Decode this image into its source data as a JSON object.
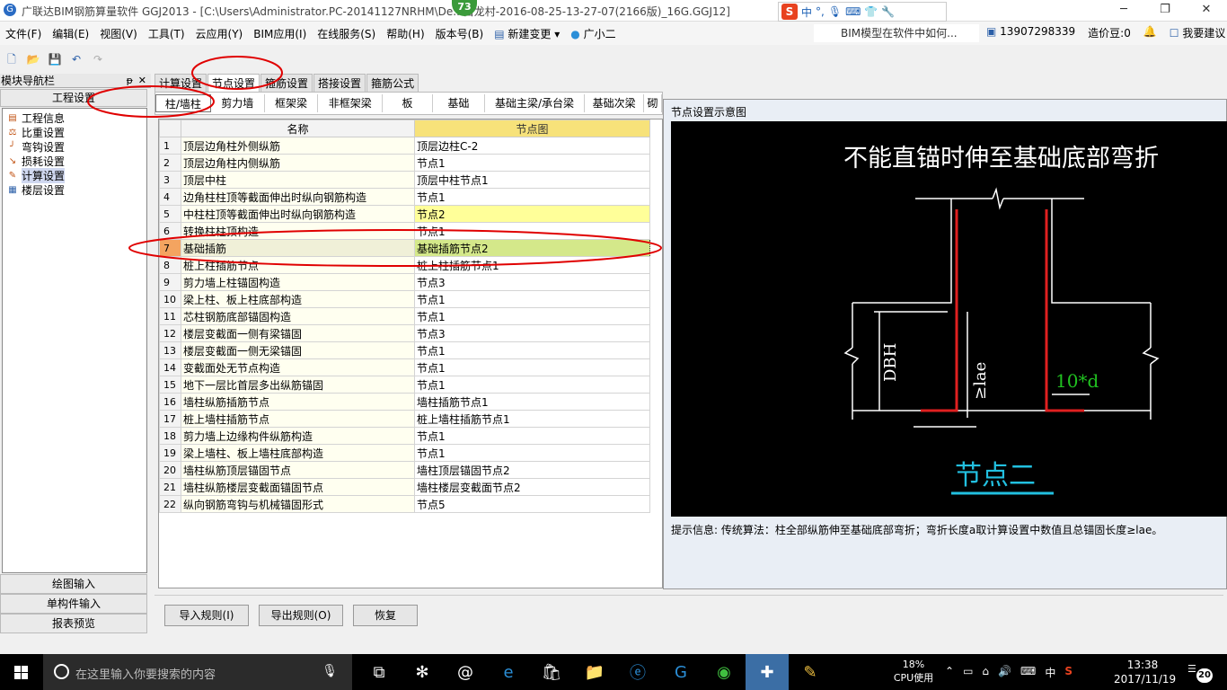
{
  "window": {
    "title": "广联达BIM钢筋算量软件 GGJ2013 - [C:\\Users\\Administrator.PC-20141127NRHM\\De...白龙村-2016-08-25-13-27-07(2166版)_16G.GGJ12]",
    "badge": "73",
    "ime": {
      "mode": "中"
    }
  },
  "menu": {
    "items": [
      "文件(F)",
      "编辑(E)",
      "视图(V)",
      "工具(T)",
      "云应用(Y)",
      "BIM应用(I)",
      "在线服务(S)",
      "帮助(H)",
      "版本号(B)",
      "新建变更",
      "广小二"
    ],
    "bim_hint": "BIM模型在软件中如何...",
    "phone": "13907298339",
    "points": "造价豆:0",
    "suggest": "我要建议"
  },
  "nav": {
    "title": "模块导航栏",
    "section": "工程设置",
    "tree": [
      {
        "label": "工程信息",
        "icon": "info-icon"
      },
      {
        "label": "比重设置",
        "icon": "weight-icon"
      },
      {
        "label": "弯钩设置",
        "icon": "hook-icon"
      },
      {
        "label": "损耗设置",
        "icon": "loss-icon"
      },
      {
        "label": "计算设置",
        "icon": "calc-icon",
        "selected": true
      },
      {
        "label": "楼层设置",
        "icon": "floor-icon"
      }
    ],
    "bottom": [
      "绘图输入",
      "单构件输入",
      "报表预览"
    ]
  },
  "main_tabs": [
    "计算设置",
    "节点设置",
    "箍筋设置",
    "搭接设置",
    "箍筋公式"
  ],
  "active_main_tab": 1,
  "sub_tabs": [
    "柱/墙柱",
    "剪力墙",
    "框架梁",
    "非框架梁",
    "板",
    "基础",
    "基础主梁/承台梁",
    "基础次梁",
    "砌"
  ],
  "grid": {
    "headers": {
      "name": "名称",
      "node": "节点图"
    },
    "rows": [
      {
        "n": "1",
        "name": "顶层边角柱外侧纵筋",
        "node": "顶层边柱C-2"
      },
      {
        "n": "2",
        "name": "顶层边角柱内侧纵筋",
        "node": "节点1"
      },
      {
        "n": "3",
        "name": "顶层中柱",
        "node": "顶层中柱节点1"
      },
      {
        "n": "4",
        "name": "边角柱柱顶等截面伸出时纵向钢筋构造",
        "node": "节点1"
      },
      {
        "n": "5",
        "name": "中柱柱顶等截面伸出时纵向钢筋构造",
        "node": "节点2"
      },
      {
        "n": "6",
        "name": "转换柱柱顶构造",
        "node": "节点1"
      },
      {
        "n": "7",
        "name": "基础插筋",
        "node": "基础插筋节点2"
      },
      {
        "n": "8",
        "name": "桩上柱插筋节点",
        "node": "桩上柱插筋节点1"
      },
      {
        "n": "9",
        "name": "剪力墙上柱锚固构造",
        "node": "节点3"
      },
      {
        "n": "10",
        "name": "梁上柱、板上柱底部构造",
        "node": "节点1"
      },
      {
        "n": "11",
        "name": "芯柱钢筋底部锚固构造",
        "node": "节点1"
      },
      {
        "n": "12",
        "name": "楼层变截面一侧有梁锚固",
        "node": "节点3"
      },
      {
        "n": "13",
        "name": "楼层变截面一侧无梁锚固",
        "node": "节点1"
      },
      {
        "n": "14",
        "name": "变截面处无节点构造",
        "node": "节点1"
      },
      {
        "n": "15",
        "name": "地下一层比首层多出纵筋锚固",
        "node": "节点1"
      },
      {
        "n": "16",
        "name": "墙柱纵筋插筋节点",
        "node": "墙柱插筋节点1"
      },
      {
        "n": "17",
        "name": "桩上墙柱插筋节点",
        "node": "桩上墙柱插筋节点1"
      },
      {
        "n": "18",
        "name": "剪力墙上边缘构件纵筋构造",
        "node": "节点1"
      },
      {
        "n": "19",
        "name": "梁上墙柱、板上墙柱底部构造",
        "node": "节点1"
      },
      {
        "n": "20",
        "name": "墙柱纵筋顶层锚固节点",
        "node": "墙柱顶层锚固节点2"
      },
      {
        "n": "21",
        "name": "墙柱纵筋楼层变截面锚固节点",
        "node": "墙柱楼层变截面节点2"
      },
      {
        "n": "22",
        "name": "纵向钢筋弯钩与机械锚固形式",
        "node": "节点5"
      }
    ]
  },
  "buttons": {
    "import": "导入规则(I)",
    "export": "导出规则(O)",
    "restore": "恢复"
  },
  "diagram": {
    "panel_title": "节点设置示意图",
    "heading": "不能直锚时伸至基础底部弯折",
    "dbh": "DBH",
    "lae": "≥lae",
    "bend": "10*d",
    "caption": "节点二",
    "hint": "提示信息:  传统算法：柱全部纵筋伸至基础底部弯折；弯折长度a取计算设置中数值且总锚固长度≥lae。"
  },
  "taskbar": {
    "search_placeholder": "在这里输入你要搜索的内容",
    "cpu_percent": "18%",
    "cpu_label": "CPU使用",
    "ime": "中",
    "time": "13:38",
    "date": "2017/11/19",
    "notifications": "20"
  },
  "colors": {
    "rebar": "#e02020",
    "caption": "#22c0e0",
    "bend_label": "#20c020",
    "highlight": "#ffff99",
    "selected_node": "#d4e88a",
    "annotation": "#e00000"
  }
}
